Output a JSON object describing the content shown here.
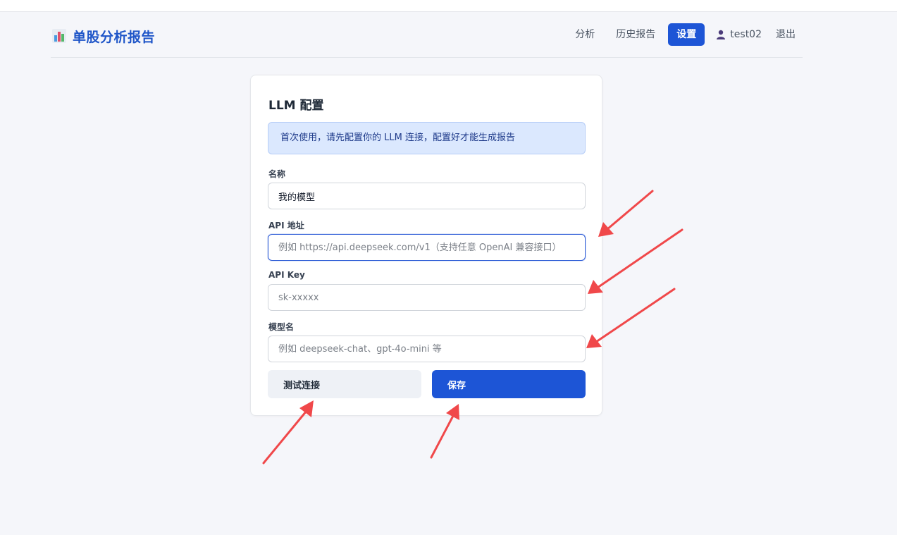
{
  "app": {
    "title": "单股分析报告",
    "brand_icon": "bar-chart-icon"
  },
  "nav": {
    "items": [
      "分析",
      "历史报告"
    ],
    "active": "设置",
    "username": "test02",
    "logout": "退出"
  },
  "form": {
    "title": "LLM 配置",
    "notice": "首次使用，请先配置你的 LLM 连接，配置好才能生成报告",
    "fields": [
      {
        "label": "名称",
        "value": "我的模型",
        "placeholder": ""
      },
      {
        "label": "API 地址",
        "value": "",
        "placeholder": "例如 https://api.deepseek.com/v1（支持任意 OpenAI 兼容接口）"
      },
      {
        "label": "API Key",
        "value": "",
        "placeholder": "sk-xxxxx"
      },
      {
        "label": "模型名",
        "value": "",
        "placeholder": "例如 deepseek-chat、gpt-4o-mini 等"
      }
    ],
    "test_button": "测试连接",
    "save_button": "保存"
  },
  "colors": {
    "primary": "#1d55d6",
    "brand_text": "#1e55c8",
    "notice_bg": "#dbe8fe",
    "annotation_arrow": "#f0484a"
  }
}
